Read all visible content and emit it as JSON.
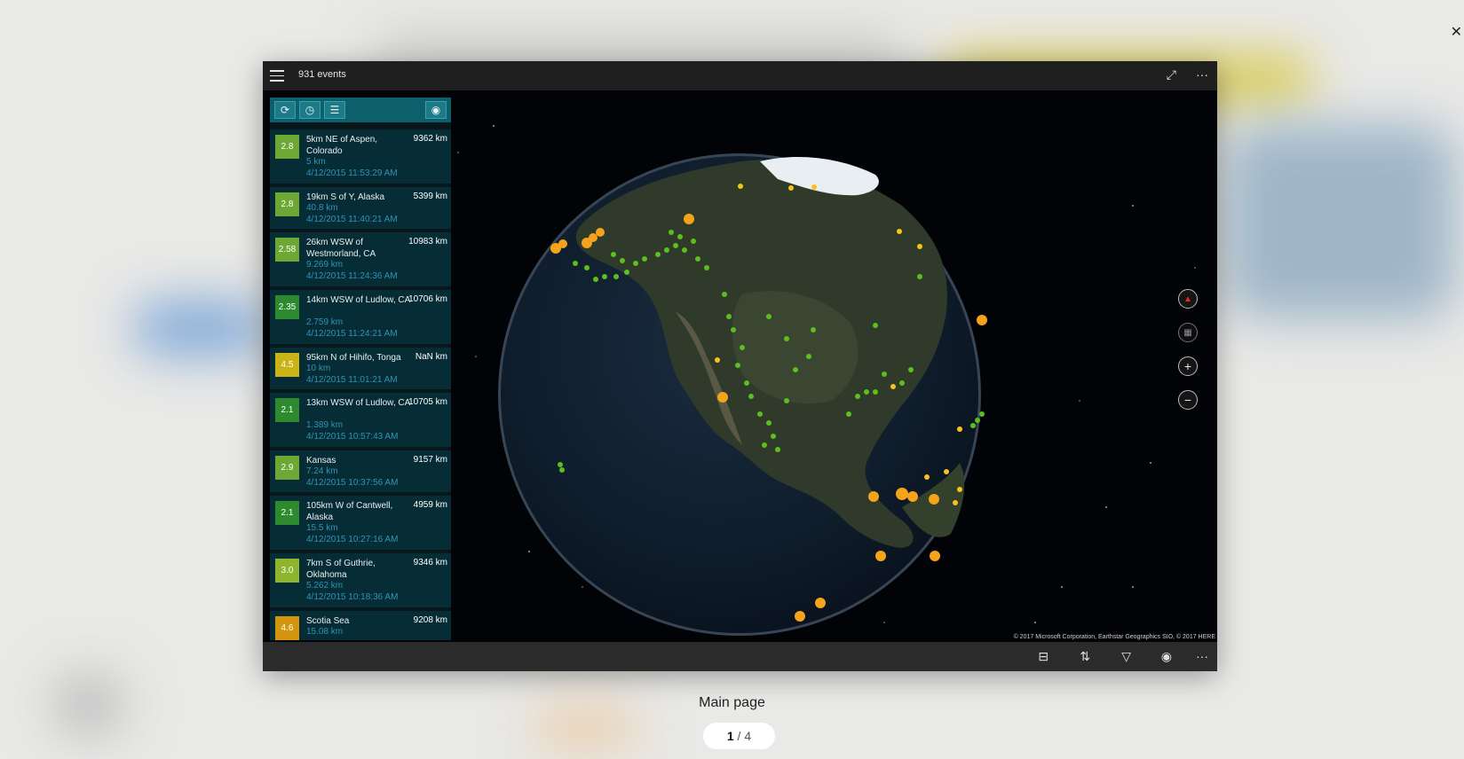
{
  "window": {
    "title": "931 events",
    "fullscreen_icon": "fullscreen-expand-icon",
    "more_icon": "ellipsis-icon"
  },
  "panel_toolbar": {
    "buttons": [
      "refresh-icon",
      "history-icon",
      "list-view-icon",
      "live-feed-icon"
    ]
  },
  "events": [
    {
      "mag": "2.8",
      "place": "5km NE of Aspen, Colorado",
      "distance": "9362 km",
      "depth": "5  km",
      "time": "4/12/2015 11:53:29 AM",
      "color": "#6ea834"
    },
    {
      "mag": "2.8",
      "place": "19km S of Y, Alaska",
      "distance": "5399 km",
      "depth": "40.8  km",
      "time": "4/12/2015 11:40:21 AM",
      "color": "#6ea834"
    },
    {
      "mag": "2.58",
      "place": "26km WSW of Westmorland, CA",
      "distance": "10983 km",
      "depth": "9.269  km",
      "time": "4/12/2015 11:24:36 AM",
      "color": "#6ea834"
    },
    {
      "mag": "2.35",
      "place": "14km WSW of Ludlow, CA",
      "distance": "10706 km",
      "depth": "2.759  km",
      "time": "4/12/2015 11:24:21 AM",
      "color": "#2e8a2e"
    },
    {
      "mag": "4.5",
      "place": "95km N of Hihifo, Tonga",
      "distance": "NaN km",
      "depth": "10  km",
      "time": "4/12/2015 11:01:21 AM",
      "color": "#c9b317"
    },
    {
      "mag": "2.1",
      "place": "13km WSW of Ludlow, CA",
      "distance": "10705 km",
      "depth": "1.389  km",
      "time": "4/12/2015 10:57:43 AM",
      "color": "#2e8a2e"
    },
    {
      "mag": "2.9",
      "place": "Kansas",
      "distance": "9157 km",
      "depth": "7.24  km",
      "time": "4/12/2015 10:37:56 AM",
      "color": "#6ea834"
    },
    {
      "mag": "2.1",
      "place": "105km W of Cantwell, Alaska",
      "distance": "4959 km",
      "depth": "15.5  km",
      "time": "4/12/2015 10:27:16 AM",
      "color": "#2e8a2e"
    },
    {
      "mag": "3.0",
      "place": "7km S of Guthrie, Oklahoma",
      "distance": "9346 km",
      "depth": "5.262  km",
      "time": "4/12/2015 10:18:36 AM",
      "color": "#8db62e"
    },
    {
      "mag": "4.6",
      "place": "Scotia Sea",
      "distance": "9208 km",
      "depth": "15.08  km",
      "time": "",
      "color": "#d4960f"
    }
  ],
  "map_controls": [
    "compass-icon",
    "tilt-icon",
    "zoom-in-icon",
    "zoom-out-icon"
  ],
  "attribution": "© 2017 Microsoft Corporation, Earthstar Geographics  SIO, © 2017 HERE",
  "bottom_bar": [
    "map-style-icon",
    "sort-icon",
    "filter-icon",
    "location-icon",
    "ellipsis-icon"
  ],
  "caption": "Main page",
  "pager": {
    "current": "1",
    "total": "/ 4"
  }
}
